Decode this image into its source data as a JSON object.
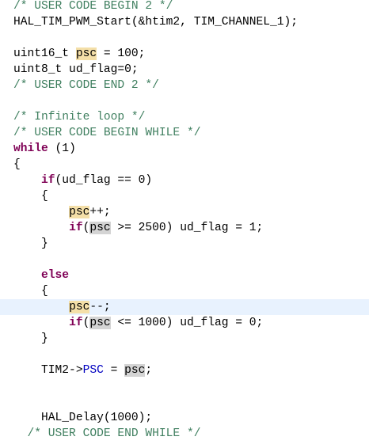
{
  "editor": {
    "lines": [
      {
        "name": "line-01",
        "tokens": [
          {
            "t": "cm",
            "v": "/* USER CODE BEGIN 2 */"
          }
        ]
      },
      {
        "name": "line-02",
        "tokens": [
          {
            "t": "",
            "v": "HAL_TIM_PWM_Start(&htim2, TIM_CHANNEL_1);"
          }
        ]
      },
      {
        "name": "line-03",
        "tokens": []
      },
      {
        "name": "line-04",
        "tokens": [
          {
            "t": "",
            "v": "uint16_t "
          },
          {
            "t": "hl-write",
            "v": "psc"
          },
          {
            "t": "",
            "v": " = 100;"
          }
        ]
      },
      {
        "name": "line-05",
        "tokens": [
          {
            "t": "",
            "v": "uint8_t ud_flag=0;"
          }
        ]
      },
      {
        "name": "line-06",
        "tokens": [
          {
            "t": "cm",
            "v": "/* USER CODE END 2 */"
          }
        ]
      },
      {
        "name": "line-07",
        "tokens": []
      },
      {
        "name": "line-08",
        "tokens": [
          {
            "t": "cm",
            "v": "/* Infinite loop */"
          }
        ]
      },
      {
        "name": "line-09",
        "tokens": [
          {
            "t": "cm",
            "v": "/* USER CODE BEGIN WHILE */"
          }
        ]
      },
      {
        "name": "line-10",
        "tokens": [
          {
            "t": "kw",
            "v": "while"
          },
          {
            "t": "",
            "v": " (1)"
          }
        ]
      },
      {
        "name": "line-11",
        "tokens": [
          {
            "t": "",
            "v": "{"
          }
        ]
      },
      {
        "name": "line-12",
        "tokens": [
          {
            "t": "",
            "v": "    "
          },
          {
            "t": "kw",
            "v": "if"
          },
          {
            "t": "",
            "v": "(ud_flag == 0)"
          }
        ]
      },
      {
        "name": "line-13",
        "tokens": [
          {
            "t": "",
            "v": "    {"
          }
        ]
      },
      {
        "name": "line-14",
        "tokens": [
          {
            "t": "",
            "v": "        "
          },
          {
            "t": "hl-write",
            "v": "psc"
          },
          {
            "t": "",
            "v": "++;"
          }
        ]
      },
      {
        "name": "line-15",
        "tokens": [
          {
            "t": "",
            "v": "        "
          },
          {
            "t": "kw",
            "v": "if"
          },
          {
            "t": "",
            "v": "("
          },
          {
            "t": "hl-read",
            "v": "psc"
          },
          {
            "t": "",
            "v": " >= 2500) ud_flag = 1;"
          }
        ]
      },
      {
        "name": "line-16",
        "tokens": [
          {
            "t": "",
            "v": "    }"
          }
        ]
      },
      {
        "name": "line-17",
        "tokens": []
      },
      {
        "name": "line-18",
        "tokens": [
          {
            "t": "",
            "v": "    "
          },
          {
            "t": "kw",
            "v": "else"
          }
        ]
      },
      {
        "name": "line-19",
        "tokens": [
          {
            "t": "",
            "v": "    {"
          }
        ]
      },
      {
        "name": "line-20",
        "current": true,
        "tokens": [
          {
            "t": "",
            "v": "        "
          },
          {
            "t": "hl-write",
            "v": "psc"
          },
          {
            "t": "",
            "v": "--;"
          }
        ]
      },
      {
        "name": "line-21",
        "tokens": [
          {
            "t": "",
            "v": "        "
          },
          {
            "t": "kw",
            "v": "if"
          },
          {
            "t": "",
            "v": "("
          },
          {
            "t": "hl-read",
            "v": "psc"
          },
          {
            "t": "",
            "v": " <= 1000) ud_flag = 0;"
          }
        ]
      },
      {
        "name": "line-22",
        "tokens": [
          {
            "t": "",
            "v": "    }"
          }
        ]
      },
      {
        "name": "line-23",
        "tokens": []
      },
      {
        "name": "line-24",
        "tokens": [
          {
            "t": "",
            "v": "    TIM2->"
          },
          {
            "t": "fld",
            "v": "PSC"
          },
          {
            "t": "",
            "v": " = "
          },
          {
            "t": "hl-read",
            "v": "psc"
          },
          {
            "t": "",
            "v": ";"
          }
        ]
      },
      {
        "name": "line-25",
        "tokens": []
      },
      {
        "name": "line-26",
        "tokens": []
      },
      {
        "name": "line-27",
        "tokens": [
          {
            "t": "",
            "v": "    HAL_Delay(1000);"
          }
        ]
      },
      {
        "name": "line-28",
        "tokens": [
          {
            "t": "cm",
            "v": "  /* USER CODE END WHILE */"
          }
        ]
      }
    ]
  }
}
